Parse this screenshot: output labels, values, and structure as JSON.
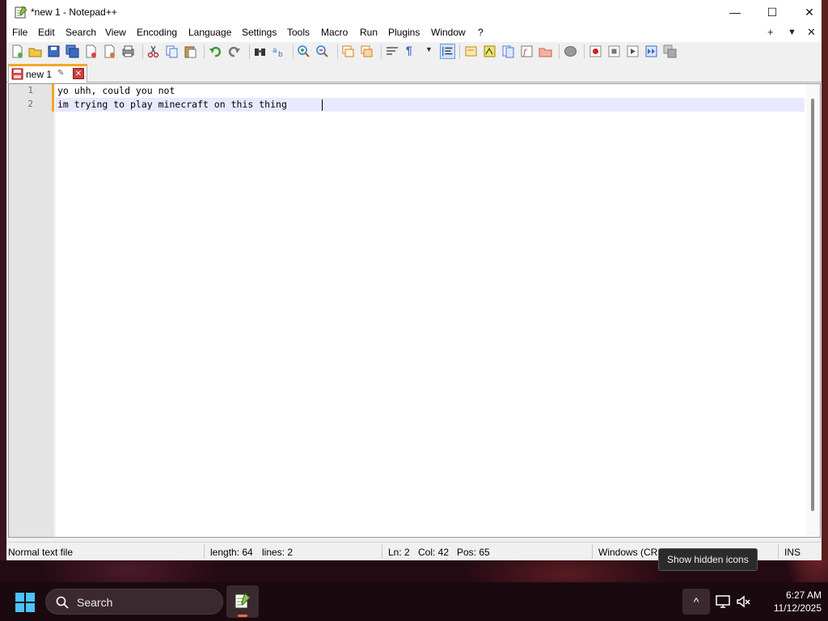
{
  "window": {
    "title": "*new 1 - Notepad++",
    "minimize_glyph": "—",
    "maximize_glyph": "☐",
    "close_glyph": "✕"
  },
  "menu": {
    "items": [
      "File",
      "Edit",
      "Search",
      "View",
      "Encoding",
      "Language",
      "Settings",
      "Tools",
      "Macro",
      "Run",
      "Plugins",
      "Window",
      "?"
    ],
    "right_plus": "+",
    "right_dropdown": "▼",
    "right_close": "✕"
  },
  "tab": {
    "label": "new 1",
    "pin_glyph": "📌",
    "close_glyph": "✕"
  },
  "editor": {
    "lines": [
      {
        "number": "1",
        "text": "yo uhh, could you not"
      },
      {
        "number": "2",
        "text": "im trying to play minecraft on this thing"
      }
    ]
  },
  "status": {
    "file_type": "Normal text file",
    "length": "length: 64",
    "lines": "lines: 2",
    "ln": "Ln: 2",
    "col": "Col: 42",
    "pos": "Pos: 65",
    "eol": "Windows (CR",
    "mode": "INS"
  },
  "tooltip": {
    "text": "Show hidden icons"
  },
  "taskbar": {
    "search_label": "Search",
    "tray_chevron": "^",
    "time": "6:27 AM",
    "date": "11/12/2025"
  },
  "colors": {
    "accent_orange": "#f5a623",
    "current_line": "#e8e8ff",
    "taskbar_bg": "#1a0a10"
  }
}
